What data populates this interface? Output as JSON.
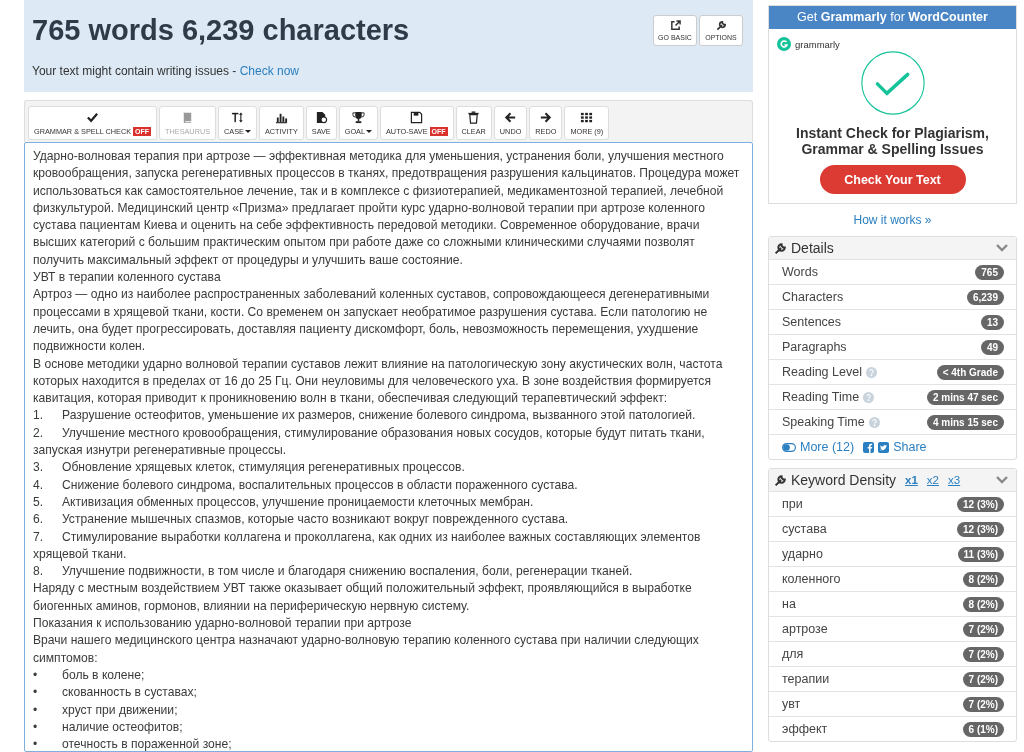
{
  "header": {
    "title": "765 words 6,239 characters",
    "issues_text": "Your text might contain writing issues - ",
    "issues_link": "Check now",
    "buttons": [
      "GO BASIC",
      "OPTIONS"
    ]
  },
  "toolbar": [
    {
      "label": "GRAMMAR & SPELL CHECK",
      "badge": "OFF",
      "disabled": false,
      "dropdown": false
    },
    {
      "label": "THESAURUS",
      "disabled": true,
      "dropdown": false
    },
    {
      "label": "CASE",
      "disabled": false,
      "dropdown": true
    },
    {
      "label": "ACTIVITY",
      "disabled": false,
      "dropdown": false
    },
    {
      "label": "SAVE",
      "disabled": false,
      "dropdown": false
    },
    {
      "label": "GOAL",
      "disabled": false,
      "dropdown": true
    },
    {
      "label": "AUTO-SAVE",
      "badge": "OFF",
      "disabled": false,
      "dropdown": false
    },
    {
      "label": "CLEAR",
      "disabled": false,
      "dropdown": false
    },
    {
      "label": "UNDO",
      "disabled": false,
      "dropdown": false
    },
    {
      "label": "REDO",
      "disabled": false,
      "dropdown": false
    },
    {
      "label": "MORE (9)",
      "disabled": false,
      "dropdown": false
    }
  ],
  "editor": [
    {
      "kind": "para",
      "text": "Ударно-волновая терапия при артрозе — эффективная методика для уменьшения, устранения боли, улучшения местного кровообращения, запуска регенеративных процессов в тканях, предотвращения разрушения кальцинатов. Процедура может использоваться как самостоятельное лечение, так и в комплексе с физиотерапией, медикаментозной терапией, лечебной физкультурой. Медицинский центр «Призма» предлагает пройти курс ударно-волновой терапии при артрозе коленного сустава пациентам Киева и оценить на себе эффективность передовой методики. Современное оборудование, врачи высших категорий с большим практическим опытом при работе даже со сложными клиническими случаями позволят получить максимальный эффект от процедуры и улучшить ваше состояние."
    },
    {
      "kind": "para",
      "text": "УВТ в терапии коленного сустава"
    },
    {
      "kind": "para",
      "text": "Артроз — одно из наиболее распространенных заболеваний коленных суставов, сопровождающееся дегенеративными процессами в хрящевой ткани, кости. Со временем он запускает необратимое разрушения сустава. Если патологию не лечить, она будет прогрессировать, доставляя пациенту дискомфорт, боль, невозможность перемещения, ухудшение подвижности колен."
    },
    {
      "kind": "para",
      "text": "В основе методики ударно волновой терапии суставов лежит влияние на патологическую зону акустических волн, частота которых находится в пределах от 16 до 25 Гц. Они неуловимы для человеческого уха. В зоне воздействия формируется кавитация, которая приводит к проникновению волн в ткани, обеспечивая следующий терапевтический эффект:"
    },
    {
      "kind": "item",
      "marker": "1.",
      "text": "Разрушение остеофитов, уменьшение их размеров, снижение болевого синдрома, вызванного этой патологией."
    },
    {
      "kind": "item",
      "marker": "2.",
      "text": "Улучшение местного кровообращения, стимулирование образования новых сосудов, которые будут питать ткани, запуская изнутри регенеративные процессы."
    },
    {
      "kind": "item",
      "marker": "3.",
      "text": "Обновление хрящевых клеток, стимуляция регенеративных процессов."
    },
    {
      "kind": "item",
      "marker": "4.",
      "text": "Снижение болевого синдрома, воспалительных процессов в области пораженного сустава."
    },
    {
      "kind": "item",
      "marker": "5.",
      "text": "Активизация обменных процессов, улучшение проницаемости клеточных мембран."
    },
    {
      "kind": "item",
      "marker": "6.",
      "text": "Устранение мышечных спазмов, которые часто возникают вокруг поврежденного сустава."
    },
    {
      "kind": "item",
      "marker": "7.",
      "text": "Стимулирование выработки коллагена и проколлагена, как одних из наиболее важных составляющих элементов хрящевой ткани."
    },
    {
      "kind": "item",
      "marker": "8.",
      "text": "Улучшение подвижности, в том числе и благодаря снижению воспаления, боли, регенерации тканей."
    },
    {
      "kind": "para",
      "text": "Наряду с местным воздействием УВТ также оказывает общий положительный эффект, проявляющийся в выработке биогенных аминов, гормонов, влиянии на периферическую нервную систему."
    },
    {
      "kind": "para",
      "text": "Показания к использованию ударно-волновой терапии при артрозе"
    },
    {
      "kind": "para",
      "text": "Врачи нашего медицинского центра назначают ударно-волновую терапию коленного сустава при наличии следующих симптомов:"
    },
    {
      "kind": "item",
      "marker": "•",
      "text": "боль в колене;"
    },
    {
      "kind": "item",
      "marker": "•",
      "text": "скованность в суставах;"
    },
    {
      "kind": "item",
      "marker": "•",
      "text": "хруст при движении;"
    },
    {
      "kind": "item",
      "marker": "•",
      "text": "наличие остеофитов;"
    },
    {
      "kind": "item",
      "marker": "•",
      "text": "отечность в пораженной зоне;"
    }
  ],
  "ad": {
    "header": "Get **Grammarly** for **WordCounter**",
    "brand": "grammarly",
    "headline": "Instant Check for Plagiarism, Grammar & Spelling Issues",
    "button": "Check Your Text",
    "link": "How it works »"
  },
  "details": {
    "title": "Details",
    "rows": [
      {
        "label": "Words",
        "value": "765",
        "help": false
      },
      {
        "label": "Characters",
        "value": "6,239",
        "help": false
      },
      {
        "label": "Sentences",
        "value": "13",
        "help": false
      },
      {
        "label": "Paragraphs",
        "value": "49",
        "help": false
      },
      {
        "label": "Reading Level",
        "value": "< 4th Grade",
        "help": true
      },
      {
        "label": "Reading Time",
        "value": "2 mins 47 sec",
        "help": true
      },
      {
        "label": "Speaking Time",
        "value": "4 mins 15 sec",
        "help": true
      }
    ],
    "more": "More (12)",
    "share": "Share"
  },
  "keywords": {
    "title": "Keyword Density",
    "tabs": [
      {
        "label": "x1",
        "selected": true
      },
      {
        "label": "x2",
        "selected": false
      },
      {
        "label": "x3",
        "selected": false
      }
    ],
    "rows": [
      {
        "word": "при",
        "count": "12 (3%)"
      },
      {
        "word": "сустава",
        "count": "12 (3%)"
      },
      {
        "word": "ударно",
        "count": "11 (3%)"
      },
      {
        "word": "коленного",
        "count": "8 (2%)"
      },
      {
        "word": "на",
        "count": "8 (2%)"
      },
      {
        "word": "артрозе",
        "count": "7 (2%)"
      },
      {
        "word": "для",
        "count": "7 (2%)"
      },
      {
        "word": "терапии",
        "count": "7 (2%)"
      },
      {
        "word": "увт",
        "count": "7 (2%)"
      },
      {
        "word": "эффект",
        "count": "6 (1%)"
      }
    ]
  }
}
